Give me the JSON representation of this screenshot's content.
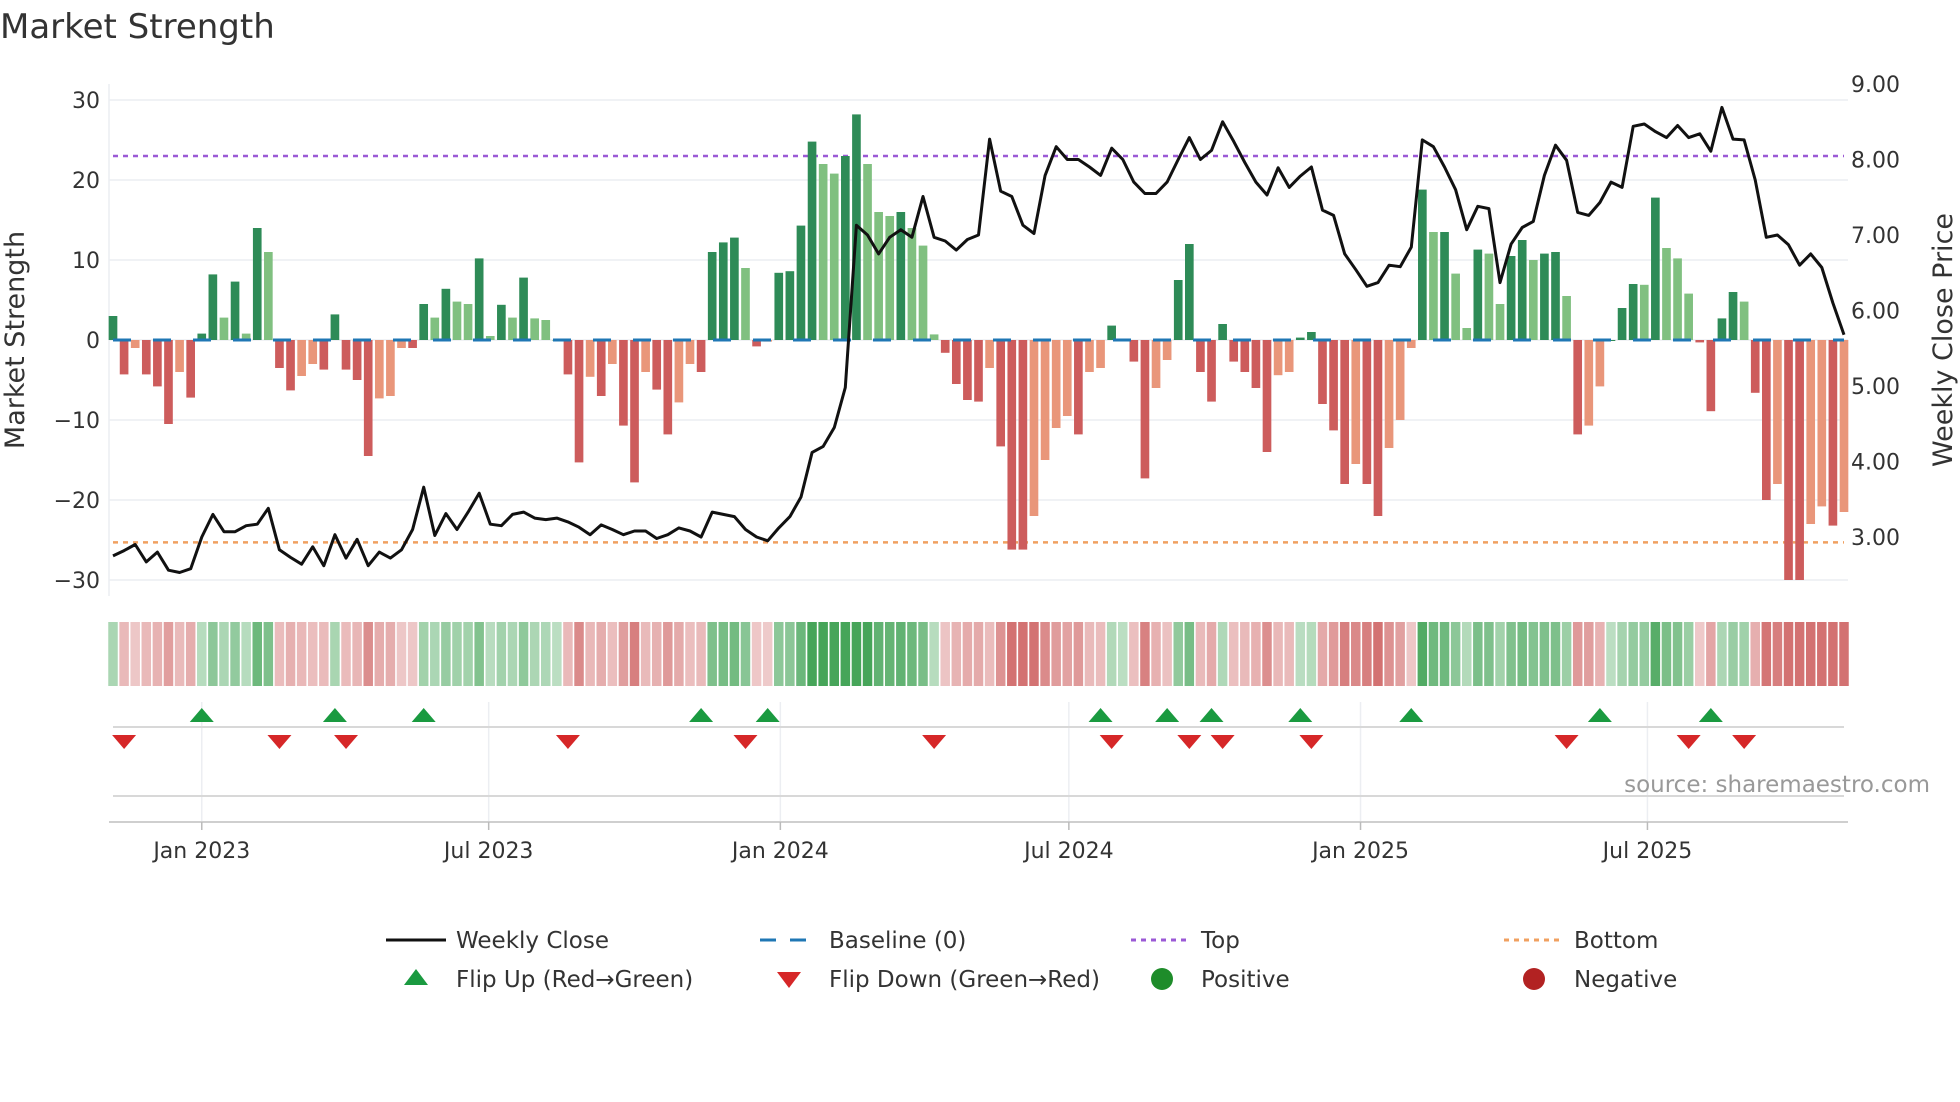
{
  "chart_data": {
    "type": "bar",
    "title": "Market Strength",
    "ylabel": "Market Strength",
    "y2label": "Weekly Close Price",
    "ylim": [
      -32,
      32
    ],
    "y2lim": [
      2.4,
      9.1
    ],
    "yticks": [
      30,
      20,
      10,
      0,
      -10,
      -20,
      -30
    ],
    "ytick_labels": [
      "30",
      "20",
      "10",
      "0",
      "−10",
      "−20",
      "−30"
    ],
    "y2ticks": [
      9,
      8,
      7,
      6,
      5,
      4,
      3
    ],
    "y2tick_labels": [
      "9.00",
      "8.00",
      "7.00",
      "6.00",
      "5.00",
      "4.00",
      "3.00"
    ],
    "x_start": "2022-11-06",
    "x_frequency": "weekly",
    "xticks": [
      "2023-01-01",
      "2023-07-01",
      "2024-01-01",
      "2024-07-01",
      "2025-01-01",
      "2025-07-01"
    ],
    "xtick_labels": [
      "Jan 2023",
      "Jul 2023",
      "Jan 2024",
      "Jul 2024",
      "Jan 2025",
      "Jul 2025"
    ],
    "top_level": 23,
    "bottom_level": -25.3,
    "baseline": 0,
    "strength": [
      3,
      -4.3,
      -1,
      -4.3,
      -5.8,
      -10.5,
      -4,
      -7.2,
      0.8,
      8.2,
      2.8,
      7.3,
      0.8,
      14,
      11,
      -3.5,
      -6.3,
      -4.5,
      -3,
      -3.7,
      3.2,
      -3.7,
      -5,
      -14.5,
      -7.3,
      -7,
      -1,
      -1,
      4.5,
      2.8,
      6.4,
      4.8,
      4.5,
      10.2,
      0.5,
      4.4,
      2.8,
      7.8,
      2.7,
      2.5,
      0,
      -4.3,
      -15.3,
      -4.6,
      -7,
      -3,
      -10.7,
      -17.8,
      -4,
      -6.2,
      -11.8,
      -7.8,
      -3,
      -4,
      11,
      12.2,
      12.8,
      9,
      -0.8,
      -0.2,
      8.4,
      8.6,
      14.3,
      24.8,
      22,
      20.8,
      23,
      28.2,
      22,
      16,
      15.5,
      16,
      14,
      11.8,
      0.7,
      -1.6,
      -5.5,
      -7.5,
      -7.7,
      -3.5,
      -13.3,
      -26.2,
      -26.2,
      -22,
      -15,
      -11,
      -9.5,
      -11.8,
      -4,
      -3.5,
      1.8,
      0,
      -2.7,
      -17.3,
      -6,
      -2.5,
      7.5,
      12,
      -4,
      -7.7,
      2,
      -2.7,
      -4,
      -6,
      -14,
      -4.4,
      -4,
      0.3,
      1,
      -8,
      -11.3,
      -18,
      -15.5,
      -18,
      -22,
      -13.5,
      -10,
      -1,
      18.8,
      13.5,
      13.5,
      8.3,
      1.5,
      11.3,
      10.8,
      4.5,
      10.5,
      12.5,
      10,
      10.8,
      11,
      5.5,
      -11.8,
      -10.7,
      -5.8,
      0,
      4,
      7,
      6.9,
      17.8,
      11.5,
      10.2,
      5.8,
      -0.3,
      -8.9,
      2.7,
      6,
      4.8,
      -6.6,
      -20,
      -18,
      -30,
      -30,
      -23,
      -20.8,
      -23.2,
      -21.5
    ],
    "weekly_close": [
      2.75,
      2.82,
      2.9,
      2.67,
      2.8,
      2.56,
      2.53,
      2.58,
      3.0,
      3.3,
      3.07,
      3.07,
      3.15,
      3.17,
      3.38,
      2.83,
      2.73,
      2.64,
      2.87,
      2.62,
      3.03,
      2.72,
      2.97,
      2.62,
      2.8,
      2.72,
      2.83,
      3.1,
      3.66,
      3.02,
      3.31,
      3.1,
      3.33,
      3.58,
      3.17,
      3.15,
      3.3,
      3.33,
      3.25,
      3.23,
      3.25,
      3.2,
      3.13,
      3.03,
      3.16,
      3.1,
      3.03,
      3.08,
      3.08,
      2.98,
      3.03,
      3.12,
      3.08,
      3.0,
      3.33,
      3.3,
      3.27,
      3.1,
      3.0,
      2.95,
      3.12,
      3.27,
      3.53,
      4.12,
      4.2,
      4.45,
      4.98,
      7.13,
      7.0,
      6.75,
      6.97,
      7.07,
      6.97,
      7.51,
      6.97,
      6.92,
      6.8,
      6.94,
      7.0,
      8.27,
      7.58,
      7.51,
      7.13,
      7.02,
      7.79,
      8.17,
      8.0,
      8.0,
      7.9,
      7.79,
      8.15,
      8.0,
      7.7,
      7.55,
      7.55,
      7.7,
      8.0,
      8.29,
      8.0,
      8.12,
      8.5,
      8.24,
      7.96,
      7.7,
      7.53,
      7.89,
      7.63,
      7.78,
      7.9,
      7.33,
      7.26,
      6.75,
      6.54,
      6.32,
      6.37,
      6.6,
      6.58,
      6.84,
      8.26,
      8.17,
      7.9,
      7.6,
      7.07,
      7.38,
      7.35,
      6.37,
      6.88,
      7.1,
      7.18,
      7.79,
      8.19,
      7.99,
      7.3,
      7.26,
      7.43,
      7.7,
      7.63,
      8.44,
      8.47,
      8.37,
      8.29,
      8.45,
      8.29,
      8.34,
      8.11,
      8.69,
      8.27,
      8.26,
      7.73,
      6.97,
      7.0,
      6.87,
      6.6,
      6.75,
      6.57,
      6.1,
      5.68
    ],
    "flip_up_weeks": [
      8,
      20,
      28,
      53,
      59,
      89,
      95,
      99,
      107,
      117,
      134,
      144
    ],
    "flip_down_weeks": [
      1,
      15,
      21,
      41,
      57,
      74,
      90,
      97,
      100,
      108,
      131,
      142,
      147
    ],
    "legend": {
      "placement": "bottom",
      "entries": [
        "Weekly Close",
        "Baseline (0)",
        "Top",
        "Bottom",
        "Flip Up (Red→Green)",
        "Flip Down (Green→Red)",
        "Positive",
        "Negative"
      ]
    },
    "annotation": "source: sharemaestro.com"
  },
  "colors": {
    "up_strong": "#2e8b57",
    "up_weak": "#80c080",
    "down_strong": "#cd5c5c",
    "down_weak": "#e9967a",
    "close": "#111111",
    "baseline": "#1f77b4",
    "top": "#9b59d6",
    "bottom": "#f0a060",
    "flip_up": "#1a9a40",
    "flip_down": "#d62728",
    "positive": "#1e8c2a",
    "negative": "#b22222"
  }
}
